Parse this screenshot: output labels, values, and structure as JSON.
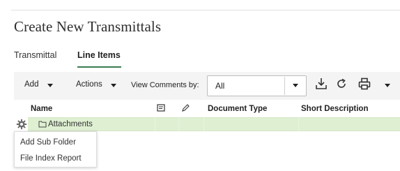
{
  "page": {
    "title": "Create New Transmittals"
  },
  "tabs": [
    {
      "label": "Transmittal",
      "active": false
    },
    {
      "label": "Line Items",
      "active": true
    }
  ],
  "toolbar": {
    "add_label": "Add",
    "actions_label": "Actions",
    "view_comments_label": "View Comments by:",
    "view_comments_select": {
      "value": "All"
    },
    "icons": [
      "download-icon",
      "refresh-icon",
      "print-icon",
      "chevron-down-icon"
    ]
  },
  "table": {
    "columns": [
      "Name",
      "comments-icon",
      "edit-icon",
      "Document Type",
      "Short Description"
    ],
    "header": {
      "name": "Name",
      "document_type": "Document Type",
      "short_description": "Short Description"
    },
    "rows": [
      {
        "icon": "folder-icon",
        "name": "Attachments",
        "selected": true
      }
    ]
  },
  "context_menu": {
    "items": [
      "Add Sub Folder",
      "File Index Report"
    ]
  },
  "colors": {
    "accent": "#3a7b4f",
    "row_highlight": "#dff0d2",
    "toolbar_bg": "#f4f4f4"
  }
}
